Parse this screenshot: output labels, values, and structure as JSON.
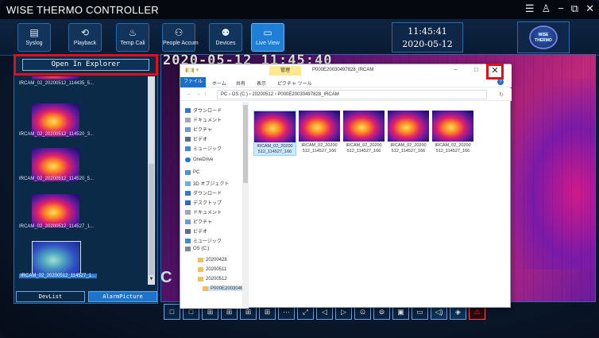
{
  "app": {
    "title": "WISE THERMO CONTROLLER",
    "window_controls": [
      "☰",
      "♙",
      "−",
      "⧉",
      "✕"
    ]
  },
  "toolbar": {
    "buttons": [
      {
        "label": "Syslog",
        "icon": "▤"
      },
      {
        "label": "Playback",
        "icon": "⟲"
      },
      {
        "label": "Temp Cali",
        "icon": "♨"
      },
      {
        "label": "People Accum",
        "icon": "⚇"
      },
      {
        "label": "Devices",
        "icon": "⚉"
      },
      {
        "label": "Live View",
        "icon": "▭"
      }
    ],
    "clock_time": "11:45:41",
    "clock_date": "2020-05-12",
    "logo_text": "WISE THERMO"
  },
  "left_panel": {
    "open_explorer_label": "Open In Explorer",
    "thumbnails": [
      {
        "caption": "IRCAM_02_20200512_114435_5..."
      },
      {
        "caption": "IRCAM_02_20200512_114520_3..."
      },
      {
        "caption": "IRCAM_02_20200512_114520_5..."
      },
      {
        "caption": "IRCAM_02_20200512_114527_1..."
      },
      {
        "caption": "IRCAM_02_20200512_114527_1..."
      }
    ],
    "tabs": [
      "DevList",
      "AlarmPicture"
    ]
  },
  "viewer": {
    "timestamp": "2020-05-12 11:45:40",
    "left_mark": "C"
  },
  "bottom_toolbar": {
    "icons": [
      "□",
      "□",
      "⊞",
      "⊞",
      "⊞",
      "⊞",
      "⋯",
      "⤢",
      "◁",
      "▷",
      "⊙",
      "⊚",
      "▣",
      "▭",
      "◁)",
      "◈",
      "⚠"
    ]
  },
  "explorer": {
    "manage_tab": "管理",
    "title_path": "P000E20030497828_IRCAM",
    "ribbon": {
      "file": "ファイル",
      "home": "ホーム",
      "share": "共有",
      "view": "表示",
      "picture_tools": "ピクチャ ツール"
    },
    "address": "PC  ›  OS (C:)  ›  20200512  ›  P000E20030497828_IRCAM",
    "nav_items": [
      "ダウンロード",
      "ドキュメント",
      "ピクチャ",
      "ビデオ",
      "ミュージック",
      "OneDrive",
      "PC",
      "3D オブジェクト",
      "ダウンロード",
      "デスクトップ",
      "ドキュメント",
      "ピクチャ",
      "ビデオ",
      "ミュージック",
      "OS (C:)",
      "20200428",
      "20200511",
      "20200512",
      "P000E2003049"
    ],
    "files": [
      {
        "name": "IRCAM_02_20200\n512_114527_166"
      },
      {
        "name": "IRCAM_02_20200\n512_114527_166"
      },
      {
        "name": "IRCAM_02_20200\n512_114527_166"
      },
      {
        "name": "IRCAM_02_20200\n512_114527_166"
      },
      {
        "name": "IRCAM_02_20200\n512_114527_166"
      }
    ]
  }
}
